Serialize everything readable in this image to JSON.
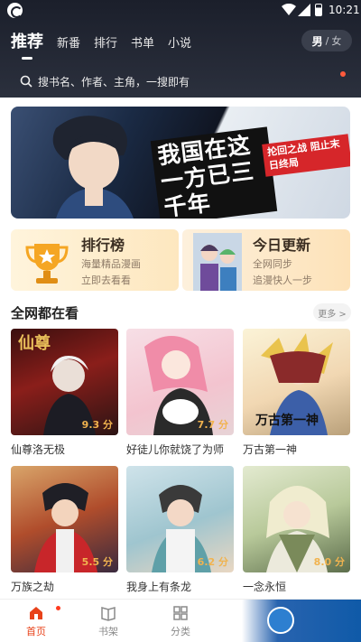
{
  "status_bar": {
    "time": "10:21"
  },
  "header": {
    "tabs": [
      {
        "label": "推荐",
        "active": true
      },
      {
        "label": "新番",
        "active": false
      },
      {
        "label": "排行",
        "active": false
      },
      {
        "label": "书单",
        "active": false
      },
      {
        "label": "小说",
        "active": false
      }
    ],
    "gender": {
      "selected": "男",
      "separator": "/",
      "other": "女"
    }
  },
  "search": {
    "placeholder": "搜书名、作者、主角，一搜即有"
  },
  "banner": {
    "headline": "我国在这一方已三千年",
    "tag": "抡回之战 阻止末日终局"
  },
  "cards": {
    "rank": {
      "title": "排行榜",
      "line1": "海量精品漫画",
      "line2": "立即去看看"
    },
    "update": {
      "title": "今日更新",
      "line1": "全网同步",
      "line2": "追漫快人一步"
    }
  },
  "section": {
    "title": "全网都在看",
    "more": "更多 >"
  },
  "comics": [
    {
      "title": "仙尊洛无极",
      "score": "9.3 分"
    },
    {
      "title": "好徒儿你就饶了为师",
      "score": "7.7 分"
    },
    {
      "title": "万古第一神",
      "score": ""
    },
    {
      "title": "万族之劫",
      "score": "5.5 分"
    },
    {
      "title": "我身上有条龙",
      "score": "6.2 分"
    },
    {
      "title": "一念永恒",
      "score": "8.0 分"
    }
  ],
  "bottom_nav": [
    {
      "label": "首页",
      "icon": "home-icon",
      "active": true
    },
    {
      "label": "书架",
      "icon": "bookshelf-icon",
      "active": false
    },
    {
      "label": "分类",
      "icon": "category-icon",
      "active": false
    }
  ],
  "colors": {
    "accent": "#e8421a",
    "header_bg": "#1b1f2b",
    "score": "#f1b34f"
  }
}
